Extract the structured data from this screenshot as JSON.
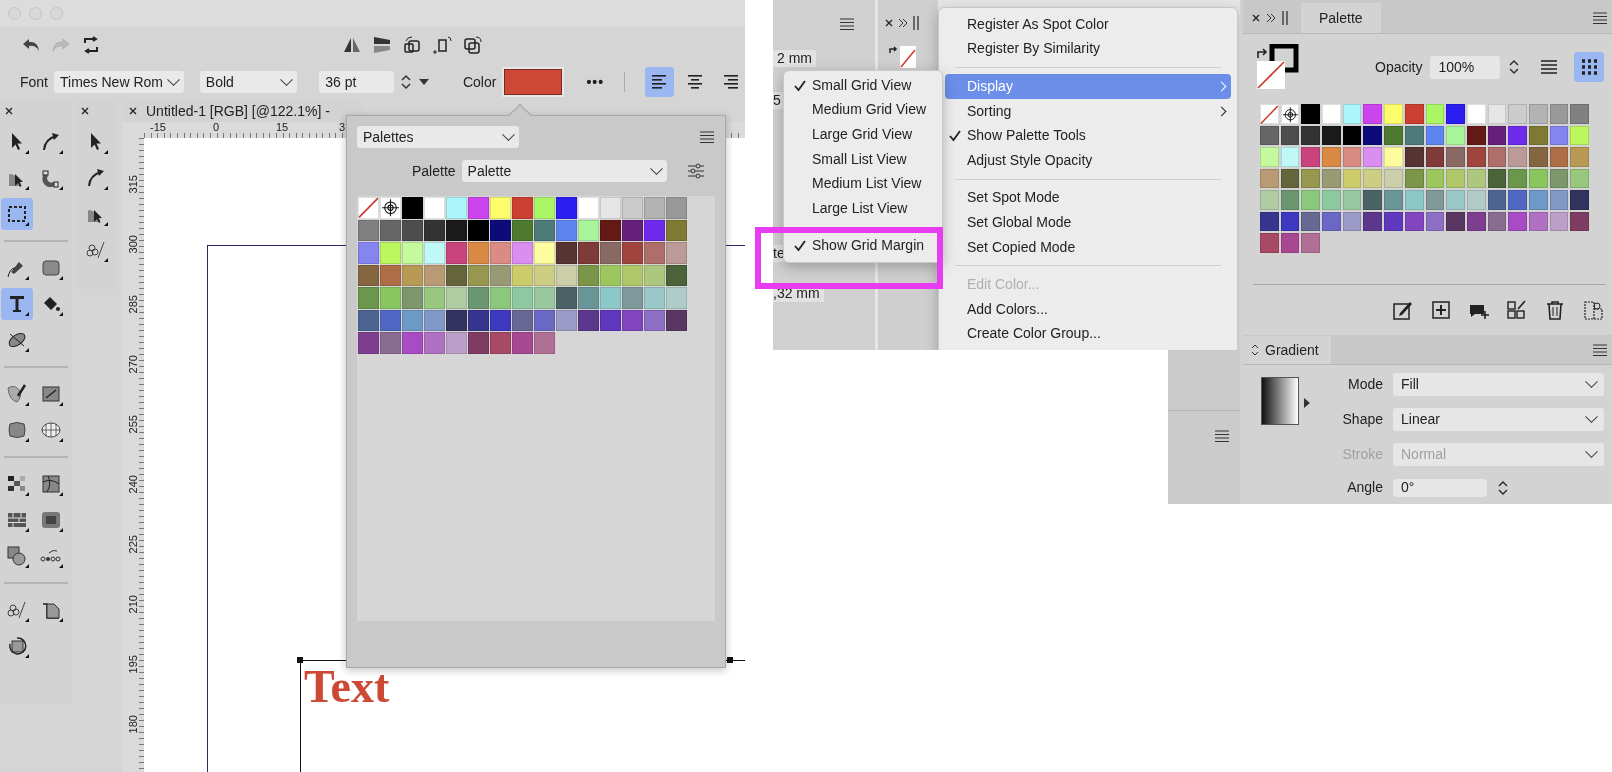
{
  "editor": {
    "context_bar": {
      "font_label": "Font",
      "font": "Times New Rom",
      "style": "Bold",
      "size": "36 pt",
      "color_label": "Color",
      "color": "#cc4a35",
      "more": "•••",
      "alignment": [
        {
          "kind": "left",
          "selected": true
        },
        {
          "kind": "center",
          "selected": false
        },
        {
          "kind": "right",
          "selected": false
        }
      ]
    },
    "tool_groups": [
      [
        {
          "kind": "pointer",
          "selected": false
        },
        {
          "kind": "node",
          "selected": false
        },
        {
          "kind": "corner",
          "selected": false
        },
        {
          "kind": "magnet",
          "selected": false
        },
        {
          "kind": "marquee",
          "selected": true
        }
      ],
      [
        {
          "kind": "pen",
          "selected": false
        },
        {
          "kind": "rectangle",
          "selected": false
        },
        {
          "kind": "text",
          "selected": true
        },
        {
          "kind": "bucket",
          "selected": false
        },
        {
          "kind": "warp",
          "selected": false
        }
      ],
      [
        {
          "kind": "brush",
          "selected": false
        },
        {
          "kind": "gradient",
          "selected": false
        },
        {
          "kind": "blob",
          "selected": false
        },
        {
          "kind": "mesh",
          "selected": false
        }
      ],
      [
        {
          "kind": "pixels",
          "selected": false
        },
        {
          "kind": "distort",
          "selected": false
        },
        {
          "kind": "bricks",
          "selected": false
        },
        {
          "kind": "bevel",
          "selected": false
        },
        {
          "kind": "shapes",
          "selected": false
        },
        {
          "kind": "dots",
          "selected": false
        }
      ],
      [
        {
          "kind": "scatter",
          "selected": false
        },
        {
          "kind": "crop",
          "selected": false
        },
        {
          "kind": "rotate",
          "selected": false
        }
      ]
    ],
    "secondary_tools": [
      {
        "kind": "pointer",
        "selected": false
      },
      {
        "kind": "node",
        "selected": false
      },
      {
        "kind": "corner",
        "selected": false
      },
      {
        "kind": "scatter",
        "selected": false
      }
    ],
    "document_tab": "Untitled-1 [RGB] [@122.1%] -",
    "ruler_horizontal": [
      "-15",
      "0",
      "15",
      "3"
    ],
    "ruler_vertical": [
      "315",
      "300",
      "285",
      "270",
      "255",
      "240",
      "225",
      "210",
      "195",
      "180"
    ],
    "canvas_text": "Text"
  },
  "palette_popup": {
    "library": "Palettes",
    "palette_label": "Palette",
    "palette": "Palette",
    "swatches": [
      {
        "kind": "none"
      },
      {
        "kind": "registration"
      },
      {
        "kind": "color",
        "color": "#000000"
      },
      {
        "kind": "color",
        "color": "#ffffff"
      },
      {
        "kind": "color",
        "color": "#aaf6fa"
      },
      {
        "kind": "color",
        "color": "#cc44ee"
      },
      {
        "kind": "color",
        "color": "#fdfc6a"
      },
      {
        "kind": "color",
        "color": "#cb3f30"
      },
      {
        "kind": "color",
        "color": "#aaf766"
      },
      {
        "kind": "color",
        "color": "#2a1ef0"
      },
      {
        "kind": "color",
        "color": "#ffffff"
      },
      {
        "kind": "color",
        "color": "#e6e6e6"
      },
      {
        "kind": "color",
        "color": "#cccccc"
      },
      {
        "kind": "color",
        "color": "#b3b3b3"
      },
      {
        "kind": "color",
        "color": "#999999"
      },
      {
        "kind": "color",
        "color": "#808080"
      },
      {
        "kind": "color",
        "color": "#666666"
      },
      {
        "kind": "color",
        "color": "#4d4d4d"
      },
      {
        "kind": "color",
        "color": "#333333"
      },
      {
        "kind": "color",
        "color": "#1a1a1a"
      },
      {
        "kind": "color",
        "color": "#000000"
      },
      {
        "kind": "color",
        "color": "#0d0a7a"
      },
      {
        "kind": "color",
        "color": "#4d7a2e"
      },
      {
        "kind": "color",
        "color": "#4f7a7a"
      },
      {
        "kind": "color",
        "color": "#5c85f0"
      },
      {
        "kind": "color",
        "color": "#a8f59a"
      },
      {
        "kind": "color",
        "color": "#641a14"
      },
      {
        "kind": "color",
        "color": "#661f7a"
      },
      {
        "kind": "color",
        "color": "#6e2aed"
      },
      {
        "kind": "color",
        "color": "#7f7a33"
      },
      {
        "kind": "color",
        "color": "#8585f0"
      },
      {
        "kind": "color",
        "color": "#bdf75f"
      },
      {
        "kind": "color",
        "color": "#c4f99d"
      },
      {
        "kind": "color",
        "color": "#c0f8f8"
      },
      {
        "kind": "color",
        "color": "#c9437d"
      },
      {
        "kind": "color",
        "color": "#d98943"
      },
      {
        "kind": "color",
        "color": "#d98b84"
      },
      {
        "kind": "color",
        "color": "#da8ef0"
      },
      {
        "kind": "color",
        "color": "#fdfd9f"
      },
      {
        "kind": "color",
        "color": "#553432"
      },
      {
        "kind": "color",
        "color": "#7f3b38"
      },
      {
        "kind": "color",
        "color": "#8a6864"
      },
      {
        "kind": "color",
        "color": "#a0453e"
      },
      {
        "kind": "color",
        "color": "#ae6e69"
      },
      {
        "kind": "color",
        "color": "#bb9a98"
      },
      {
        "kind": "color",
        "color": "#866641"
      },
      {
        "kind": "color",
        "color": "#ad6e47"
      },
      {
        "kind": "color",
        "color": "#b89a55"
      },
      {
        "kind": "color",
        "color": "#ba9a75"
      },
      {
        "kind": "color",
        "color": "#65653b"
      },
      {
        "kind": "color",
        "color": "#97974f"
      },
      {
        "kind": "color",
        "color": "#999a74"
      },
      {
        "kind": "color",
        "color": "#cccd6a"
      },
      {
        "kind": "color",
        "color": "#cdcd84"
      },
      {
        "kind": "color",
        "color": "#cccda9"
      },
      {
        "kind": "color",
        "color": "#7b9649"
      },
      {
        "kind": "color",
        "color": "#9bc75e"
      },
      {
        "kind": "color",
        "color": "#b0c869"
      },
      {
        "kind": "color",
        "color": "#aec77e"
      },
      {
        "kind": "color",
        "color": "#4a6339"
      },
      {
        "kind": "color",
        "color": "#6a974c"
      },
      {
        "kind": "color",
        "color": "#89c75e"
      },
      {
        "kind": "color",
        "color": "#7d976c"
      },
      {
        "kind": "color",
        "color": "#98c77e"
      },
      {
        "kind": "color",
        "color": "#b0cca3"
      },
      {
        "kind": "color",
        "color": "#6a9670"
      },
      {
        "kind": "color",
        "color": "#8cc87c"
      },
      {
        "kind": "color",
        "color": "#8dc9a0"
      },
      {
        "kind": "color",
        "color": "#99c8a0"
      },
      {
        "kind": "color",
        "color": "#4b6366"
      },
      {
        "kind": "color",
        "color": "#6a9697"
      },
      {
        "kind": "color",
        "color": "#8dc8c9"
      },
      {
        "kind": "color",
        "color": "#7f9899"
      },
      {
        "kind": "color",
        "color": "#9ac8c9"
      },
      {
        "kind": "color",
        "color": "#b0ccc9"
      },
      {
        "kind": "color",
        "color": "#4d6593"
      },
      {
        "kind": "color",
        "color": "#5068c4"
      },
      {
        "kind": "color",
        "color": "#6c99c6"
      },
      {
        "kind": "color",
        "color": "#7f98c6"
      },
      {
        "kind": "color",
        "color": "#33335f"
      },
      {
        "kind": "color",
        "color": "#37358e"
      },
      {
        "kind": "color",
        "color": "#3d38c0"
      },
      {
        "kind": "color",
        "color": "#676893"
      },
      {
        "kind": "color",
        "color": "#6a68c4"
      },
      {
        "kind": "color",
        "color": "#9c9bc7"
      },
      {
        "kind": "color",
        "color": "#5b388e"
      },
      {
        "kind": "color",
        "color": "#6038c0"
      },
      {
        "kind": "color",
        "color": "#8145c0"
      },
      {
        "kind": "color",
        "color": "#8c6ec5"
      },
      {
        "kind": "color",
        "color": "#5a3762"
      },
      {
        "kind": "color",
        "color": "#7f3d90"
      },
      {
        "kind": "color",
        "color": "#8a6b91"
      },
      {
        "kind": "color",
        "color": "#a84bc4"
      },
      {
        "kind": "color",
        "color": "#b070c3"
      },
      {
        "kind": "color",
        "color": "#bd9ec9"
      },
      {
        "kind": "color",
        "color": "#7f3c62"
      },
      {
        "kind": "color",
        "color": "#a84a65"
      },
      {
        "kind": "color",
        "color": "#a84893"
      },
      {
        "kind": "color",
        "color": "#b06f95"
      }
    ]
  },
  "menu_screenshot": {
    "fields": [
      "2 mm",
      "5",
      "te",
      ",32 mm"
    ],
    "context_menu": [
      {
        "kind": "item",
        "label": "Register As Spot Color",
        "checked": false,
        "disabled": false,
        "highlighted": false,
        "submenu": false
      },
      {
        "kind": "item",
        "label": "Register By Similarity",
        "checked": false,
        "disabled": false,
        "highlighted": false,
        "submenu": false
      },
      {
        "kind": "separator"
      },
      {
        "kind": "item",
        "label": "Display",
        "checked": false,
        "disabled": false,
        "highlighted": true,
        "submenu": true
      },
      {
        "kind": "item",
        "label": "Sorting",
        "checked": false,
        "disabled": false,
        "highlighted": false,
        "submenu": true
      },
      {
        "kind": "item",
        "label": "Show Palette Tools",
        "checked": true,
        "disabled": false,
        "highlighted": false,
        "submenu": false
      },
      {
        "kind": "item",
        "label": "Adjust Style Opacity",
        "checked": false,
        "disabled": false,
        "highlighted": false,
        "submenu": false
      },
      {
        "kind": "separator"
      },
      {
        "kind": "item",
        "label": "Set Spot Mode",
        "checked": false,
        "disabled": false,
        "highlighted": false,
        "submenu": false
      },
      {
        "kind": "item",
        "label": "Set Global Mode",
        "checked": false,
        "disabled": false,
        "highlighted": false,
        "submenu": false
      },
      {
        "kind": "item",
        "label": "Set Copied Mode",
        "checked": false,
        "disabled": false,
        "highlighted": false,
        "submenu": false
      },
      {
        "kind": "separator"
      },
      {
        "kind": "item",
        "label": "Edit Color...",
        "checked": false,
        "disabled": true,
        "highlighted": false,
        "submenu": false
      },
      {
        "kind": "item",
        "label": "Add Colors...",
        "checked": false,
        "disabled": false,
        "highlighted": false,
        "submenu": false
      },
      {
        "kind": "item",
        "label": "Create Color Group...",
        "checked": false,
        "disabled": false,
        "highlighted": false,
        "submenu": false
      }
    ],
    "submenu": [
      {
        "kind": "item",
        "label": "Small Grid View",
        "checked": true
      },
      {
        "kind": "item",
        "label": "Medium Grid View",
        "checked": false
      },
      {
        "kind": "item",
        "label": "Large Grid View",
        "checked": false
      },
      {
        "kind": "item",
        "label": "Small List View",
        "checked": false
      },
      {
        "kind": "item",
        "label": "Medium List View",
        "checked": false
      },
      {
        "kind": "item",
        "label": "Large List View",
        "checked": false
      },
      {
        "kind": "separator"
      },
      {
        "kind": "item",
        "label": "Show Grid Margin",
        "checked": true
      }
    ]
  },
  "palette_panel": {
    "tab": "Palette",
    "opacity_label": "Opacity",
    "opacity": "100%",
    "views": [
      {
        "kind": "list",
        "selected": false
      },
      {
        "kind": "grid",
        "selected": true
      }
    ],
    "swatches": [
      {
        "kind": "none"
      },
      {
        "kind": "registration"
      },
      {
        "kind": "color",
        "color": "#000000"
      },
      {
        "kind": "color",
        "color": "#ffffff"
      },
      {
        "kind": "color",
        "color": "#aaf6fa"
      },
      {
        "kind": "color",
        "color": "#cc44ee"
      },
      {
        "kind": "color",
        "color": "#fdfc6a"
      },
      {
        "kind": "color",
        "color": "#cb3f30"
      },
      {
        "kind": "color",
        "color": "#aaf766"
      },
      {
        "kind": "color",
        "color": "#2a1ef0"
      },
      {
        "kind": "color",
        "color": "#ffffff"
      },
      {
        "kind": "color",
        "color": "#e6e6e6"
      },
      {
        "kind": "color",
        "color": "#cccccc"
      },
      {
        "kind": "color",
        "color": "#b3b3b3"
      },
      {
        "kind": "color",
        "color": "#999999"
      },
      {
        "kind": "color",
        "color": "#808080"
      },
      {
        "kind": "color",
        "color": "#666666"
      },
      {
        "kind": "color",
        "color": "#4d4d4d"
      },
      {
        "kind": "color",
        "color": "#333333"
      },
      {
        "kind": "color",
        "color": "#1a1a1a"
      },
      {
        "kind": "color",
        "color": "#000000"
      },
      {
        "kind": "color",
        "color": "#0d0a7a"
      },
      {
        "kind": "color",
        "color": "#4d7a2e"
      },
      {
        "kind": "color",
        "color": "#4f7a7a"
      },
      {
        "kind": "color",
        "color": "#5c85f0"
      },
      {
        "kind": "color",
        "color": "#a8f59a"
      },
      {
        "kind": "color",
        "color": "#641a14"
      },
      {
        "kind": "color",
        "color": "#661f7a"
      },
      {
        "kind": "color",
        "color": "#6e2aed"
      },
      {
        "kind": "color",
        "color": "#7f7a33"
      },
      {
        "kind": "color",
        "color": "#8585f0"
      },
      {
        "kind": "color",
        "color": "#bdf75f"
      },
      {
        "kind": "color",
        "color": "#c4f99d"
      },
      {
        "kind": "color",
        "color": "#c0f8f8"
      },
      {
        "kind": "color",
        "color": "#c9437d"
      },
      {
        "kind": "color",
        "color": "#d98943"
      },
      {
        "kind": "color",
        "color": "#d98b84"
      },
      {
        "kind": "color",
        "color": "#da8ef0"
      },
      {
        "kind": "color",
        "color": "#fdfd9f"
      },
      {
        "kind": "color",
        "color": "#553432"
      },
      {
        "kind": "color",
        "color": "#7f3b38"
      },
      {
        "kind": "color",
        "color": "#8a6864"
      },
      {
        "kind": "color",
        "color": "#a0453e"
      },
      {
        "kind": "color",
        "color": "#ae6e69"
      },
      {
        "kind": "color",
        "color": "#bb9a98"
      },
      {
        "kind": "color",
        "color": "#866641"
      },
      {
        "kind": "color",
        "color": "#ad6e47"
      },
      {
        "kind": "color",
        "color": "#b89a55"
      },
      {
        "kind": "color",
        "color": "#ba9a75"
      },
      {
        "kind": "color",
        "color": "#65653b"
      },
      {
        "kind": "color",
        "color": "#97974f"
      },
      {
        "kind": "color",
        "color": "#999a74"
      },
      {
        "kind": "color",
        "color": "#cccd6a"
      },
      {
        "kind": "color",
        "color": "#cdcd84"
      },
      {
        "kind": "color",
        "color": "#cccda9"
      },
      {
        "kind": "color",
        "color": "#7b9649"
      },
      {
        "kind": "color",
        "color": "#9bc75e"
      },
      {
        "kind": "color",
        "color": "#b0c869"
      },
      {
        "kind": "color",
        "color": "#aec77e"
      },
      {
        "kind": "color",
        "color": "#4a6339"
      },
      {
        "kind": "color",
        "color": "#6a974c"
      },
      {
        "kind": "color",
        "color": "#89c75e"
      },
      {
        "kind": "color",
        "color": "#7d976c"
      },
      {
        "kind": "color",
        "color": "#98c77e"
      },
      {
        "kind": "color",
        "color": "#b0cca3"
      },
      {
        "kind": "color",
        "color": "#6a9670"
      },
      {
        "kind": "color",
        "color": "#8cc87c"
      },
      {
        "kind": "color",
        "color": "#8dc9a0"
      },
      {
        "kind": "color",
        "color": "#99c8a0"
      },
      {
        "kind": "color",
        "color": "#4b6366"
      },
      {
        "kind": "color",
        "color": "#6a9697"
      },
      {
        "kind": "color",
        "color": "#8dc8c9"
      },
      {
        "kind": "color",
        "color": "#7f9899"
      },
      {
        "kind": "color",
        "color": "#9ac8c9"
      },
      {
        "kind": "color",
        "color": "#b0ccc9"
      },
      {
        "kind": "color",
        "color": "#4d6593"
      },
      {
        "kind": "color",
        "color": "#5068c4"
      },
      {
        "kind": "color",
        "color": "#6c99c6"
      },
      {
        "kind": "color",
        "color": "#7f98c6"
      },
      {
        "kind": "color",
        "color": "#33335f"
      },
      {
        "kind": "color",
        "color": "#37358e"
      },
      {
        "kind": "color",
        "color": "#3d38c0"
      },
      {
        "kind": "color",
        "color": "#676893"
      },
      {
        "kind": "color",
        "color": "#6a68c4"
      },
      {
        "kind": "color",
        "color": "#9c9bc7"
      },
      {
        "kind": "color",
        "color": "#5b388e"
      },
      {
        "kind": "color",
        "color": "#6038c0"
      },
      {
        "kind": "color",
        "color": "#8145c0"
      },
      {
        "kind": "color",
        "color": "#8c6ec5"
      },
      {
        "kind": "color",
        "color": "#5a3762"
      },
      {
        "kind": "color",
        "color": "#7f3d90"
      },
      {
        "kind": "color",
        "color": "#8a6b91"
      },
      {
        "kind": "color",
        "color": "#a84bc4"
      },
      {
        "kind": "color",
        "color": "#b070c3"
      },
      {
        "kind": "color",
        "color": "#bd9ec9"
      },
      {
        "kind": "color",
        "color": "#7f3c62"
      },
      {
        "kind": "color",
        "color": "#a84a65"
      },
      {
        "kind": "color",
        "color": "#a84893"
      },
      {
        "kind": "color",
        "color": "#b06f95"
      }
    ]
  },
  "gradient_panel": {
    "tab": "Gradient",
    "fields": [
      {
        "label": "Mode",
        "value": "Fill",
        "disabled": false
      },
      {
        "label": "Shape",
        "value": "Linear",
        "disabled": false
      },
      {
        "label": "Stroke",
        "value": "Normal",
        "disabled": true
      }
    ],
    "angle_label": "Angle",
    "angle": "0°"
  }
}
